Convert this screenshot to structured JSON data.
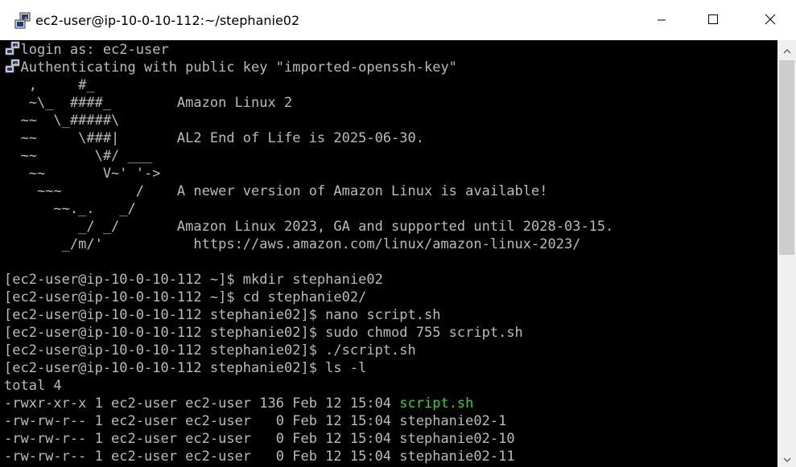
{
  "window": {
    "title": "ec2-user@ip-10-0-10-112:~/stephanie02",
    "app_icon": "putty-icon",
    "controls": {
      "minimize_icon": "minimize-icon",
      "maximize_icon": "maximize-icon",
      "close_icon": "close-icon"
    }
  },
  "terminal": {
    "colors": {
      "background": "#000000",
      "text": "#bbbbbb",
      "executable": "#2ed62e"
    },
    "lines": [
      "  login as: ec2-user",
      "  Authenticating with public key \"imported-openssh-key\"",
      "   ,     #_",
      "   ~\\_  ####_        Amazon Linux 2",
      "  ~~  \\_#####\\",
      "  ~~     \\###|       AL2 End of Life is 2025-06-30.",
      "  ~~       \\#/ ___",
      "   ~~       V~' '->",
      "    ~~~         /    A newer version of Amazon Linux is available!",
      "      ~~._.   _/",
      "         _/ _/       Amazon Linux 2023, GA and supported until 2028-03-15.",
      "       _/m/'           https://aws.amazon.com/linux/amazon-linux-2023/",
      "",
      "[ec2-user@ip-10-0-10-112 ~]$ mkdir stephanie02",
      "[ec2-user@ip-10-0-10-112 ~]$ cd stephanie02/",
      "[ec2-user@ip-10-0-10-112 stephanie02]$ nano script.sh",
      "[ec2-user@ip-10-0-10-112 stephanie02]$ sudo chmod 755 script.sh",
      "[ec2-user@ip-10-0-10-112 stephanie02]$ ./script.sh",
      "[ec2-user@ip-10-0-10-112 stephanie02]$ ls -l",
      "total 4",
      "-rwxr-xr-x 1 ec2-user ec2-user 136 Feb 12 15:04 ",
      "-rw-rw-r-- 1 ec2-user ec2-user   0 Feb 12 15:04 stephanie02-1",
      "-rw-rw-r-- 1 ec2-user ec2-user   0 Feb 12 15:04 stephanie02-10",
      "-rw-rw-r-- 1 ec2-user ec2-user   0 Feb 12 15:04 stephanie02-11"
    ],
    "executable_name": "script.sh"
  },
  "scrollbar": {
    "up_icon": "scroll-up-arrow-icon",
    "down_icon": "scroll-down-arrow-icon"
  }
}
